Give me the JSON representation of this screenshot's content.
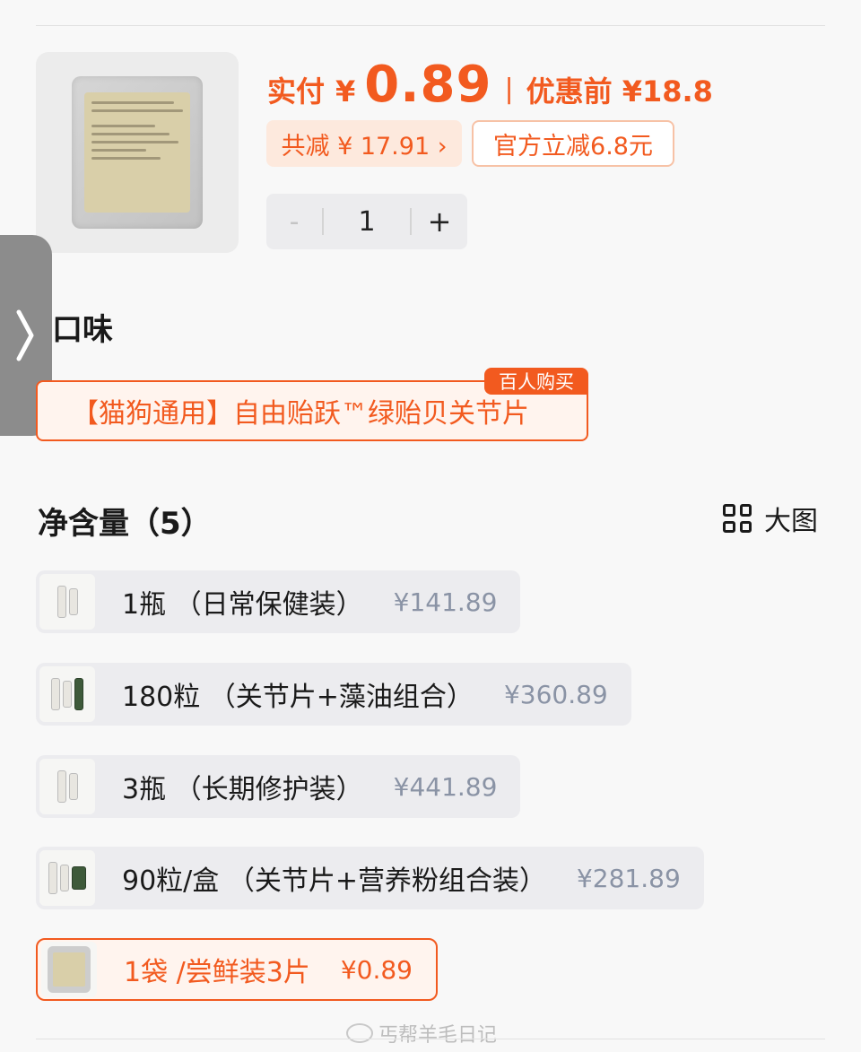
{
  "product": {
    "image_icon": "sachet-product-image",
    "paid_label": "实付",
    "paid_currency": "¥",
    "paid_amount": "0.89",
    "separator": "|",
    "before_discount": "优惠前 ¥18.8",
    "total_reduction": "共减 ¥ 17.91 ›",
    "official_discount": "官方立减6.8元"
  },
  "stepper": {
    "minus": "-",
    "quantity": "1",
    "plus": "+"
  },
  "side_tab": {
    "icon": "chevron-right-icon"
  },
  "flavor": {
    "title": "口味",
    "badge": "百人购买",
    "option": "【猫狗通用】自由贻跃™绿贻贝关节片"
  },
  "size": {
    "title": "净含量（5）",
    "big_view_label": "大图",
    "big_view_icon": "grid-icon",
    "options": [
      {
        "name": "1瓶 （日常保健装）",
        "price": "¥141.89",
        "selected": false
      },
      {
        "name": "180粒 （关节片+藻油组合）",
        "price": "¥360.89",
        "selected": false
      },
      {
        "name": "3瓶 （长期修护装）",
        "price": "¥441.89",
        "selected": false
      },
      {
        "name": "90粒/盒 （关节片+营养粉组合装）",
        "price": "¥281.89",
        "selected": false
      },
      {
        "name": "1袋 /尝鲜装3片",
        "price": "¥0.89",
        "selected": true
      }
    ]
  },
  "watermark": "丐帮羊毛日记",
  "colors": {
    "accent": "#f25a1f",
    "price_gray": "#8a93a5",
    "option_bg": "#ececef",
    "selected_bg": "#fff4ee"
  }
}
